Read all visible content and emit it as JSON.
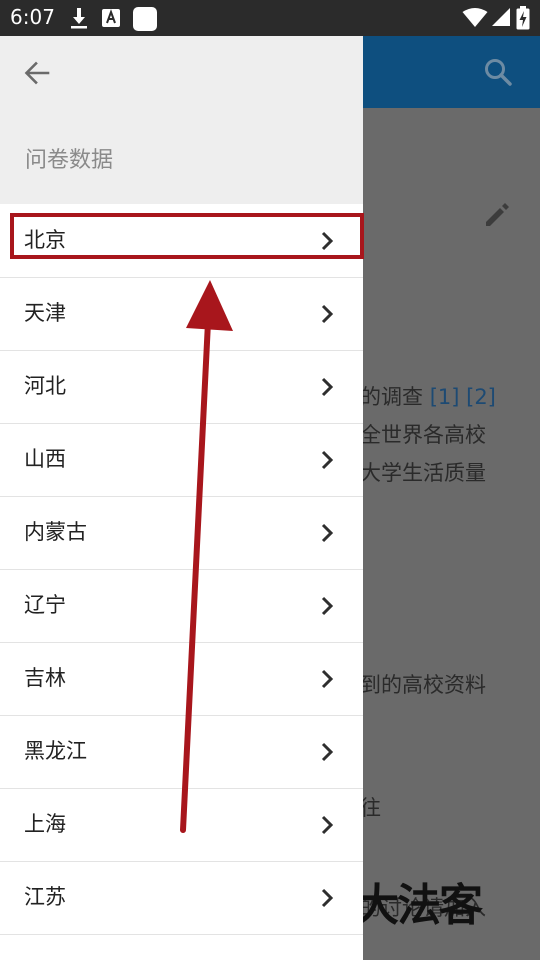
{
  "status_bar": {
    "time": "6:07",
    "icons": [
      "download-icon",
      "text-app-icon",
      "white-square-icon",
      "wifi-icon",
      "signal-icon",
      "battery-charging-icon"
    ]
  },
  "page": {
    "toolbar_icon": "search-icon",
    "edit_icon": "pencil-icon",
    "text_lines": [
      {
        "text": "的调查 ",
        "refs": [
          "[1]",
          "[2]"
        ]
      },
      {
        "text": "全世界各高校"
      },
      {
        "text": "大学生活质量"
      },
      {
        "text": "到的高校资料"
      },
      {
        "text": "往"
      },
      {
        "text": "的讨论请加入"
      }
    ],
    "watermark": "大法客"
  },
  "drawer": {
    "back_icon": "arrow-back-icon",
    "title": "问卷数据",
    "items": [
      {
        "label": "北京"
      },
      {
        "label": "天津"
      },
      {
        "label": "河北"
      },
      {
        "label": "山西"
      },
      {
        "label": "内蒙古"
      },
      {
        "label": "辽宁"
      },
      {
        "label": "吉林"
      },
      {
        "label": "黑龙江"
      },
      {
        "label": "上海"
      },
      {
        "label": "江苏"
      }
    ],
    "chevron_icon": "chevron-right-icon"
  },
  "colors": {
    "status_bar": "#2b2b2b",
    "toolbar": "#0e4f7f",
    "scrim": "#6a6a6a",
    "drawer_header": "#eeeeee",
    "annotation": "#a8161c"
  }
}
